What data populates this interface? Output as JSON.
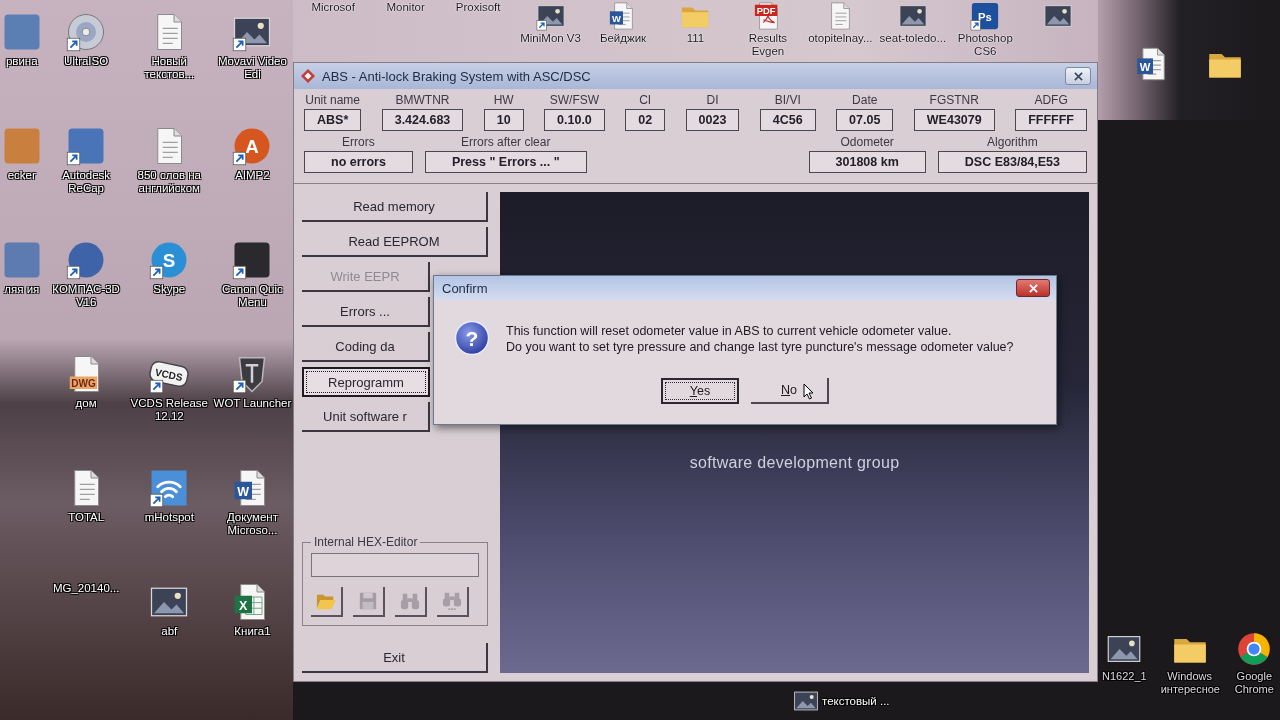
{
  "desktop": {
    "top_icons": [
      {
        "label": "Microsof",
        "shortcut": false
      },
      {
        "label": "Monitor",
        "shortcut": false
      },
      {
        "label": "Proxisoft",
        "shortcut": false
      },
      {
        "label": "MiniMon V3",
        "kind": "photo",
        "shortcut": true
      },
      {
        "label": "Бейджик",
        "kind": "word",
        "glyph": "W",
        "shortcut": false
      },
      {
        "label": "111",
        "kind": "folder",
        "shortcut": false
      },
      {
        "label": "Results Evgen",
        "kind": "pdf",
        "glyph": "PDF",
        "shortcut": false
      },
      {
        "label": "otopitelnay...",
        "kind": "doc",
        "shortcut": false
      },
      {
        "label": "seat-toledo...",
        "kind": "photo",
        "shortcut": false
      },
      {
        "label": "Photoshop CS6",
        "kind": "app",
        "color": "#1e4f9c",
        "glyph": "Ps",
        "shortcut": true
      },
      {
        "kind": "photo",
        "shortcut": false
      }
    ],
    "icon_columns": [
      [
        {
          "label": "рвина",
          "kind": "app",
          "color": "#5b7fb2",
          "shortcut": false
        },
        {
          "label": "ecker",
          "kind": "app",
          "color": "#c9803e",
          "shortcut": false
        },
        {
          "label": "ляя ия",
          "kind": "app",
          "color": "#5d7bb0",
          "shortcut": false
        }
      ],
      [
        {
          "label": "UltraISO",
          "kind": "disc",
          "shortcut": true
        },
        {
          "label": "Autodesk ReCap",
          "kind": "app",
          "color": "#4a74b8",
          "shortcut": true
        },
        {
          "label": "КОМПАС-3D V16",
          "kind": "circle",
          "color": "#3f63a8",
          "shortcut": true
        },
        {
          "label": "дом",
          "kind": "file",
          "glyph": "DWG",
          "shortcut": false
        },
        {
          "label": "TOTAL",
          "kind": "doc",
          "shortcut": false
        },
        {
          "label": "MG_20140...",
          "shortcut": false
        }
      ],
      [
        {
          "label": "Новый текстов...",
          "kind": "doc",
          "shortcut": false
        },
        {
          "label": "850 слов на английском",
          "kind": "doc",
          "shortcut": false
        },
        {
          "label": "Skype",
          "kind": "circle",
          "color": "#2b8fd6",
          "glyph": "S",
          "shortcut": true
        },
        {
          "label": "VCDS Release 12.12",
          "kind": "badge",
          "glyph": "VCDS",
          "shortcut": true
        },
        {
          "label": "mHotspot",
          "kind": "wifi",
          "shortcut": true
        },
        {
          "label": "abf",
          "kind": "photo",
          "shortcut": false
        }
      ],
      [
        {
          "label": "Movavi Video Edi",
          "kind": "photo",
          "shortcut": true
        },
        {
          "label": "AIMP2",
          "kind": "circle",
          "color": "#d5561e",
          "glyph": "A",
          "shortcut": true
        },
        {
          "label": "Canon Quic Menu",
          "kind": "app",
          "color": "#2a2a2e",
          "shortcut": true
        },
        {
          "label": "WOT Launcher",
          "kind": "shield",
          "shortcut": true
        },
        {
          "label": "Документ Microso...",
          "kind": "word",
          "glyph": "W",
          "shortcut": false
        },
        {
          "label": "Книга1",
          "kind": "excel",
          "glyph": "X",
          "shortcut": false
        }
      ]
    ],
    "bottom_icons": [
      {
        "label": "текстовый ...",
        "kind": "photo",
        "shortcut": false
      }
    ],
    "right_top_icons": [
      {
        "kind": "word",
        "glyph": "W",
        "shortcut": false
      },
      {
        "kind": "folder",
        "shortcut": false
      }
    ],
    "right_bottom_icons": [
      {
        "label": "N1622_1",
        "kind": "photo",
        "shortcut": false
      },
      {
        "label": "Windows интересное",
        "kind": "folder",
        "shortcut": false
      },
      {
        "label": "Google Chrome",
        "kind": "ring",
        "shortcut": false
      }
    ]
  },
  "window": {
    "title": "ABS - Anti-lock Braking System with ASC/DSC",
    "info_fields": [
      {
        "label": "Unit name",
        "value": "ABS*"
      },
      {
        "label": "BMWTNR",
        "value": "3.424.683"
      },
      {
        "label": "HW",
        "value": "10"
      },
      {
        "label": "SW/FSW",
        "value": "0.10.0"
      },
      {
        "label": "CI",
        "value": "02"
      },
      {
        "label": "DI",
        "value": "0023"
      },
      {
        "label": "BI/VI",
        "value": "4C56"
      },
      {
        "label": "Date",
        "value": "07.05"
      },
      {
        "label": "FGSTNR",
        "value": "WE43079"
      },
      {
        "label": "ADFG",
        "value": "FFFFFF"
      }
    ],
    "status_fields": [
      {
        "label": "Errors",
        "value": "no errors"
      },
      {
        "label": "Errors after clear",
        "value": "Press \" Errors ... \""
      }
    ],
    "vehicle_fields": [
      {
        "label": "Odometer",
        "value": "301808 km"
      },
      {
        "label": "Algorithm",
        "value": "DSC E83/84,E53"
      }
    ],
    "actions": [
      {
        "label": "Read memory",
        "disabled": false,
        "focused": false
      },
      {
        "label": "Read EEPROM",
        "disabled": false,
        "focused": false
      },
      {
        "label": "Write EEPR",
        "disabled": true,
        "focused": false
      },
      {
        "label": "Errors ...",
        "disabled": false,
        "focused": false
      },
      {
        "label": "Coding da",
        "disabled": false,
        "focused": false
      },
      {
        "label": "Reprogramm",
        "disabled": false,
        "focused": true
      },
      {
        "label": "Unit software r",
        "disabled": false,
        "focused": false
      }
    ],
    "hex_editor": {
      "title": "Internal HEX-Editor",
      "tools": [
        {
          "kind": "open",
          "disabled": false
        },
        {
          "kind": "save",
          "disabled": true
        },
        {
          "kind": "find",
          "disabled": true
        },
        {
          "kind": "find-next",
          "disabled": true
        }
      ]
    },
    "exit_button": "Exit",
    "logo": {
      "tagline": "software development group"
    }
  },
  "dialog": {
    "title": "Confirm",
    "icon_glyph": "?",
    "message_lines": [
      "This function will reset odometer value in ABS to current vehicle odometer value.",
      "Do you want to set tyre pressure and change last tyre puncture's message odometer value?"
    ],
    "buttons": [
      {
        "label": "Yes",
        "focused": true
      },
      {
        "label": "No",
        "focused": false
      }
    ]
  }
}
